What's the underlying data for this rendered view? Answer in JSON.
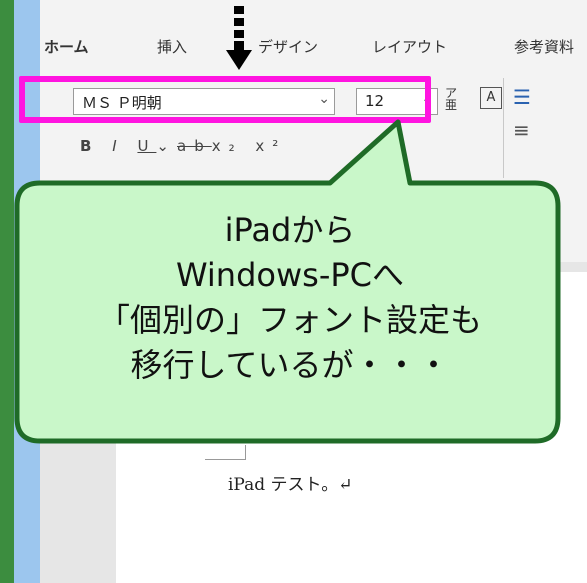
{
  "ribbon": {
    "tabs": [
      "ホーム",
      "挿入",
      "デザイン",
      "レイアウト",
      "参考資料"
    ],
    "font_name": "ＭＳ Ｐ明朝",
    "font_size": "12",
    "dropdown_symbol": "⌄"
  },
  "document": {
    "text": "iPad テスト。↵"
  },
  "callout": {
    "lines": [
      "iPadから",
      "Windows-PCへ",
      "「個別の」フォント設定も",
      "移行しているが・・・"
    ]
  },
  "colors": {
    "highlight": "#ff14e0",
    "callout_fill": "#c9f7c9",
    "callout_border": "#1f6b27"
  }
}
